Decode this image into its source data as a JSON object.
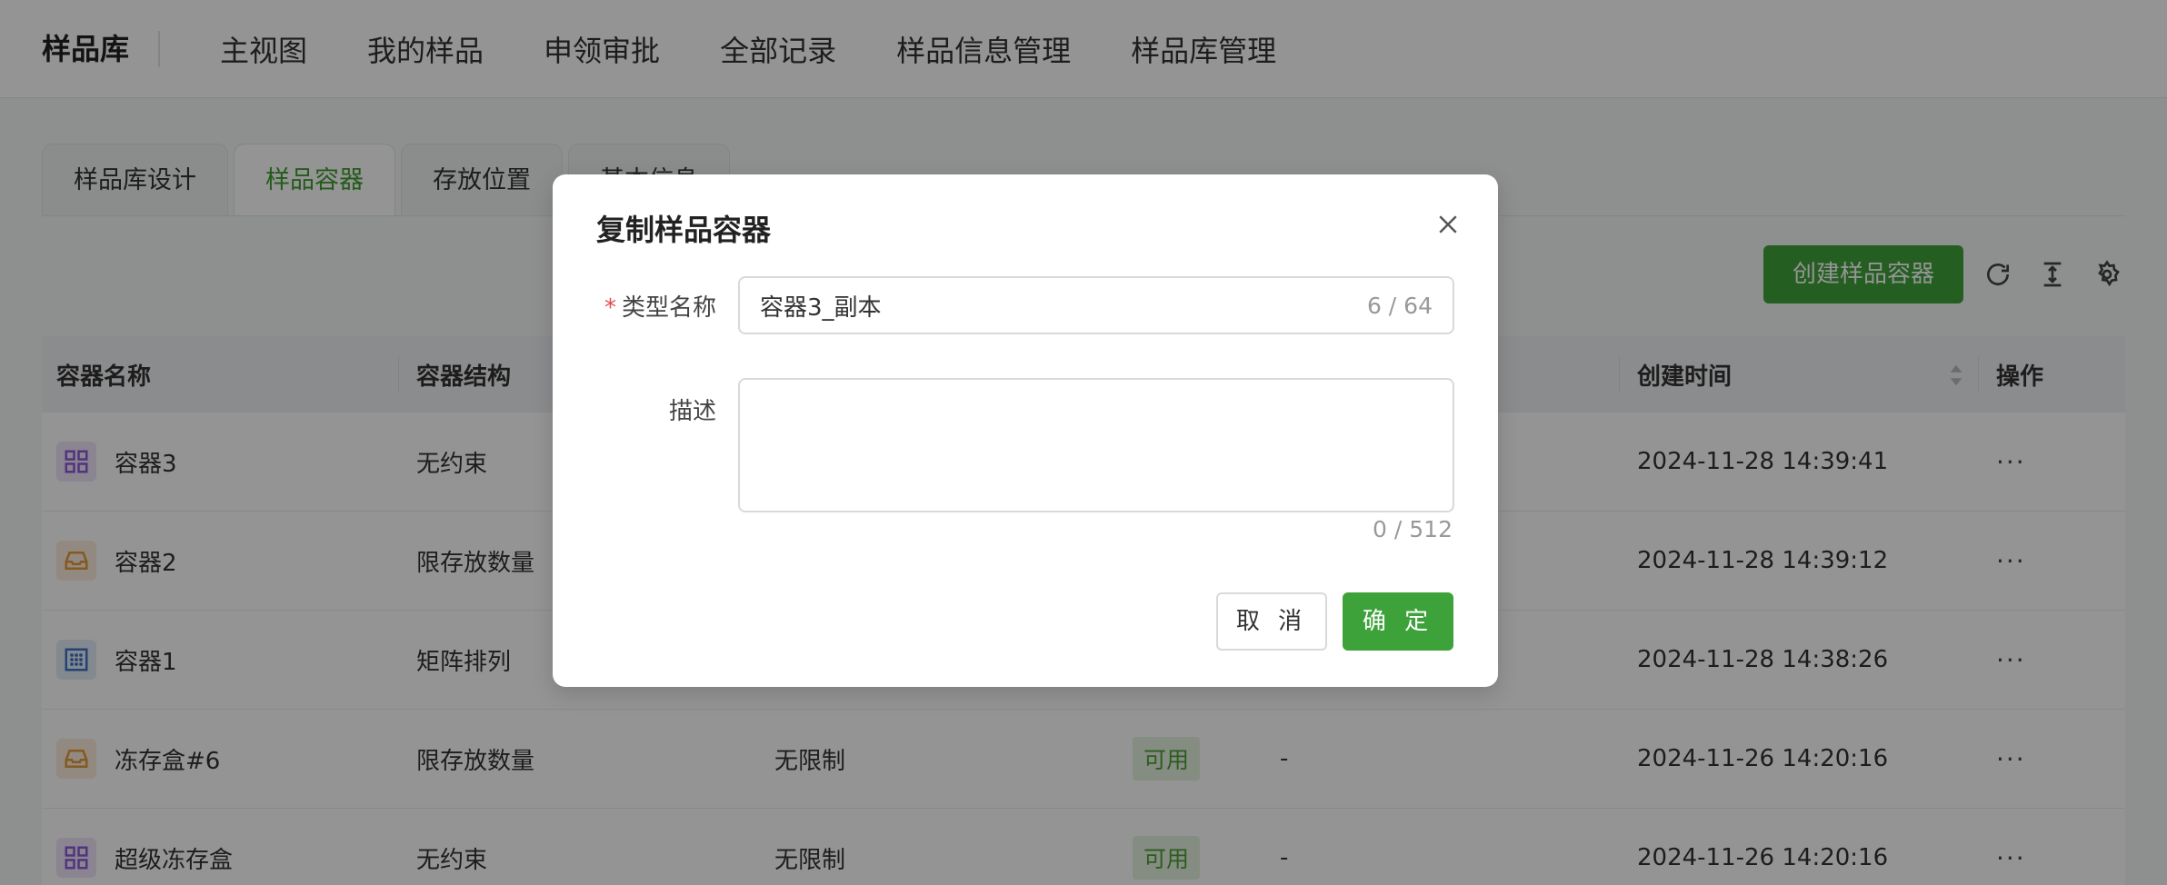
{
  "nav": {
    "brand": "样品库",
    "items": [
      "主视图",
      "我的样品",
      "申领审批",
      "全部记录",
      "样品信息管理",
      "样品库管理"
    ]
  },
  "tabs": [
    "样品库设计",
    "样品容器",
    "存放位置",
    "基本信息"
  ],
  "toolbar": {
    "create_label": "创建样品容器"
  },
  "table": {
    "headers": [
      "容器名称",
      "容器结构",
      "",
      "",
      "",
      "创建时间",
      "操作"
    ],
    "rows": [
      {
        "name": "容器3",
        "icon": "grid-icon",
        "structure": "无约束",
        "capacity": "",
        "status": "",
        "note": "",
        "created": "2024-11-28 14:39:41",
        "action": "···"
      },
      {
        "name": "容器2",
        "icon": "inbox-icon",
        "structure": "限存放数量",
        "capacity": "",
        "status": "",
        "note": "",
        "created": "2024-11-28 14:39:12",
        "action": "···"
      },
      {
        "name": "容器1",
        "icon": "matrix-icon",
        "structure": "矩阵排列",
        "capacity": "",
        "status": "",
        "note": "",
        "created": "2024-11-28 14:38:26",
        "action": "···"
      },
      {
        "name": "冻存盒#6",
        "icon": "inbox-icon",
        "structure": "限存放数量",
        "capacity": "无限制",
        "status": "可用",
        "note": "-",
        "created": "2024-11-26 14:20:16",
        "action": "···"
      },
      {
        "name": "超级冻存盒",
        "icon": "grid-icon",
        "structure": "无约束",
        "capacity": "无限制",
        "status": "可用",
        "note": "-",
        "created": "2024-11-26 14:20:16",
        "action": "···"
      }
    ]
  },
  "modal": {
    "title": "复制样品容器",
    "name_label": "类型名称",
    "required_mark": "*",
    "name_value": "容器3_副本",
    "name_counter": "6 / 64",
    "desc_label": "描述",
    "desc_counter": "0 / 512",
    "cancel_label": "取 消",
    "ok_label": "确 定"
  },
  "colors": {
    "accent": "#3ea23a",
    "tab_active": "#3f9e2f"
  }
}
